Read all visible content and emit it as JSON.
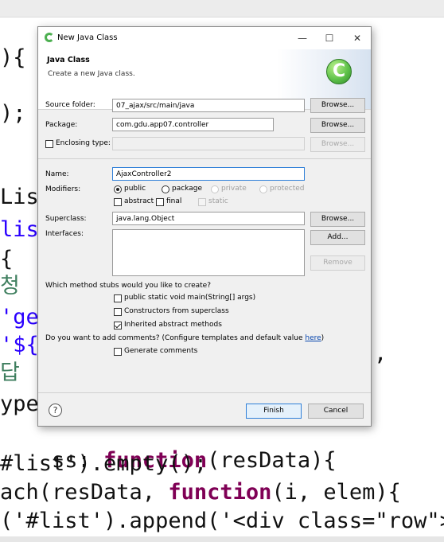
{
  "dialog": {
    "title": "New Java Class",
    "window_buttons": {
      "minimize": "—",
      "maximize": "☐",
      "close": "✕"
    },
    "banner": {
      "title": "Java Class",
      "subtitle": "Create a new Java class."
    },
    "source_folder": {
      "label": "Source folder:",
      "value": "07_ajax/src/main/java",
      "browse": "Browse..."
    },
    "package": {
      "label": "Package:",
      "value": "com.gdu.app07.controller",
      "browse": "Browse..."
    },
    "enclosing_type": {
      "label": "Enclosing type:",
      "value": "",
      "browse": "Browse...",
      "checked": false
    },
    "name": {
      "label": "Name:",
      "value": "AjaxController2"
    },
    "modifiers": {
      "label": "Modifiers:",
      "public": "public",
      "package": "package",
      "private": "private",
      "protected": "protected",
      "abstract": "abstract",
      "final": "final",
      "static": "static",
      "selected": "public"
    },
    "superclass": {
      "label": "Superclass:",
      "value": "java.lang.Object",
      "browse": "Browse..."
    },
    "interfaces": {
      "label": "Interfaces:",
      "add": "Add...",
      "remove": "Remove"
    },
    "stubs": {
      "question": "Which method stubs would you like to create?",
      "main": {
        "label": "public static void main(String[] args)",
        "checked": false
      },
      "constructors": {
        "label": "Constructors from superclass",
        "checked": false
      },
      "inherited": {
        "label": "Inherited abstract methods",
        "checked": true
      }
    },
    "comments": {
      "question_prefix": "Do you want to add comments? (Configure templates and default value ",
      "link": "here",
      "question_suffix": ")",
      "generate": {
        "label": "Generate comments",
        "checked": false
      }
    },
    "help": "?",
    "finish": "Finish",
    "cancel": "Cancel"
  },
  "editor": {
    "lines": [
      "){",
      ");",
      "List",
      "list",
      "{",
      "청",
      "'ge",
      "'${c",
      "답",
      "ype",
      "ss: function(resData){",
      "#list').empty();",
      "ach(resData, function(i, elem){",
      "('#list').append('<div class=\"row\"><",
      ","
    ]
  },
  "colors": {
    "keyword": "#7f0055",
    "string": "#2a00ff",
    "comment": "#3f7f5f",
    "accent": "#2f7fd8"
  }
}
